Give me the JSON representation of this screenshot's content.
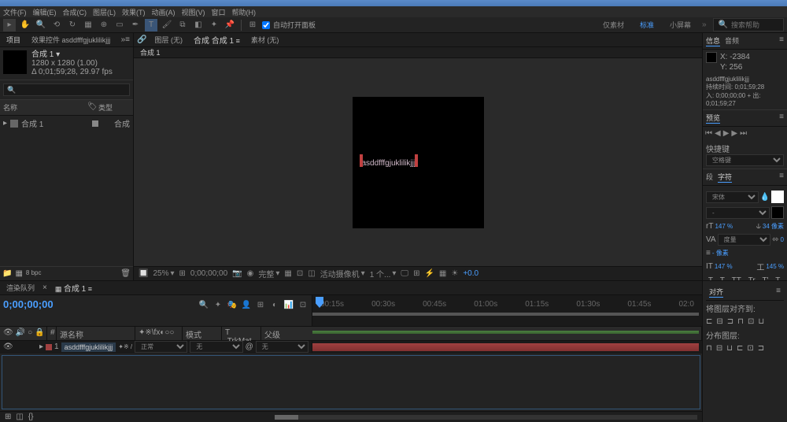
{
  "menus": [
    "文件(F)",
    "编辑(E)",
    "合成(C)",
    "图层(L)",
    "效果(T)",
    "动画(A)",
    "视图(V)",
    "窗口",
    "帮助(H)"
  ],
  "toolbar": {
    "auto_open_panel": "自动打开面板",
    "workspace_tabs": [
      "仅素材",
      "标准",
      "小屏幕"
    ],
    "search_placeholder": "搜索帮助"
  },
  "project": {
    "tab1": "项目",
    "tab2": "效果控件 asddfffgjuklilikjjj",
    "comp_name": "合成 1",
    "dimensions": "1280 x 1280 (1.00)",
    "duration": "Δ 0;01;59;28, 29.97 fps",
    "col_name": "名称",
    "col_type": "类型",
    "item_name": "合成 1",
    "item_type": "合成"
  },
  "viewer": {
    "tabs": [
      "图层 (无)",
      "合成 合成 1",
      "素材 (无)"
    ],
    "active_tab": "合成 1",
    "text_content": "asddfffgjuklilikjjj",
    "zoom": "25%",
    "time": "0;00;00;00",
    "quality": "完整",
    "camera": "活动摄像机",
    "views": "1 个...",
    "exposure": "+0.0"
  },
  "info": {
    "tab1": "信息",
    "tab2": "音频",
    "x": "X: -2384",
    "y": "Y: 256",
    "layer_name": "asddfffgjuklilikjjj",
    "duration_label": "持续时间: 0;01;59;28",
    "in_out": "入: 0;00;00;00 + 出: 0;01;59;27"
  },
  "preview": {
    "title": "预览"
  },
  "shortcuts": {
    "title": "快捷键",
    "value": "空格键"
  },
  "align": {
    "title": "对齐"
  },
  "character": {
    "tab1": "段",
    "tab2": "字符",
    "font": "宋体",
    "size": "147 %",
    "tracking": "147 %",
    "leading": "34 像素",
    "scale": "145 %",
    "stroke": "- 像素",
    "btns": [
      "T",
      "T",
      "TT",
      "Tr",
      "T'",
      "T,"
    ]
  },
  "timeline": {
    "tab1": "渲染队列",
    "tab2": "合成 1",
    "timecode": "0;00;00;00",
    "col_source": "源名称",
    "col_mode": "模式",
    "col_trkmat": "T .TrkMat",
    "col_parent": "父级",
    "layer_name": "asddfffgjuklilikjjj",
    "mode": "正常",
    "trkmat": "无",
    "parent": "无",
    "marks": [
      "00:15s",
      "00:30s",
      "00:45s",
      "01:00s",
      "01:15s",
      "01:30s",
      "01:45s",
      "02:0"
    ]
  },
  "tracker": {
    "title": "对齐",
    "row1": "将图层对齐到:",
    "row2": "分布图层:"
  }
}
